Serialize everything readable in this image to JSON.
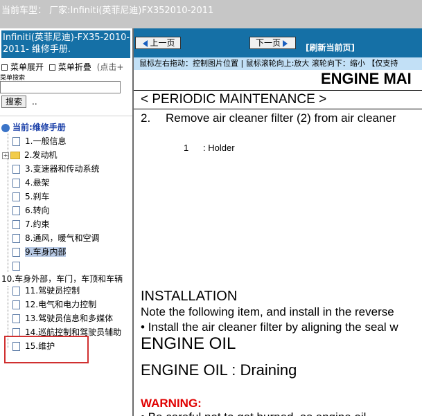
{
  "window": {
    "title": "当前车型：  厂家:Infiniti(英菲尼迪)FX352010-2011"
  },
  "left_header": {
    "line1": "Infiniti(英菲尼迪)-FX35-2010-",
    "line2": "2011- 维修手册."
  },
  "menu": {
    "expand": "菜单展开",
    "collapse": "菜单折叠",
    "hint": "(点击+"
  },
  "search": {
    "label": "菜单搜索",
    "value": "",
    "button": "搜索",
    "dots": ".."
  },
  "tree": {
    "current": "当前:维修手册",
    "items": [
      "1.一般信息",
      "2.发动机",
      "3.变速器和传动系统",
      "4.悬架",
      "5.刹车",
      "6.转向",
      "7.约束",
      "8.通风，暖气和空调",
      "9.车身内部",
      "",
      "10.车身外部，车门，车顶和车辆",
      "11.驾驶员控制",
      "12.电气和电力控制",
      "13.驾驶员信息和多媒体",
      "14.巡航控制和驾驶员辅助",
      "15.维护"
    ]
  },
  "nav": {
    "prev": "上一页",
    "next": "下一页",
    "refresh": "[刷新当前页]"
  },
  "hint": "鼠标左右拖动：控制图片位置 | 鼠标滚轮向上:放大  滚轮向下：缩小  【仅支持",
  "doc": {
    "section_title": "ENGINE MAI",
    "subsection": "< PERIODIC MAINTENANCE >",
    "step_num": "2.",
    "step_text": "Remove air cleaner filter (2) from air cleaner",
    "legend_num": "1",
    "legend_text": ": Holder",
    "install_title": "INSTALLATION",
    "install_note": "Note the following item, and install in the reverse",
    "install_bullet": "• Install the air cleaner filter by aligning the seal w",
    "oil_title": "ENGINE OIL",
    "oil_sub": "ENGINE OIL : Draining",
    "warning": "WARNING:",
    "warning_line": "• Be careful not to get burned, as engine oil"
  },
  "colors": {
    "header_blue": "#1570a6",
    "hint_bg": "#c2e0f6",
    "highlight": "#d03030",
    "warning": "#e00000"
  }
}
